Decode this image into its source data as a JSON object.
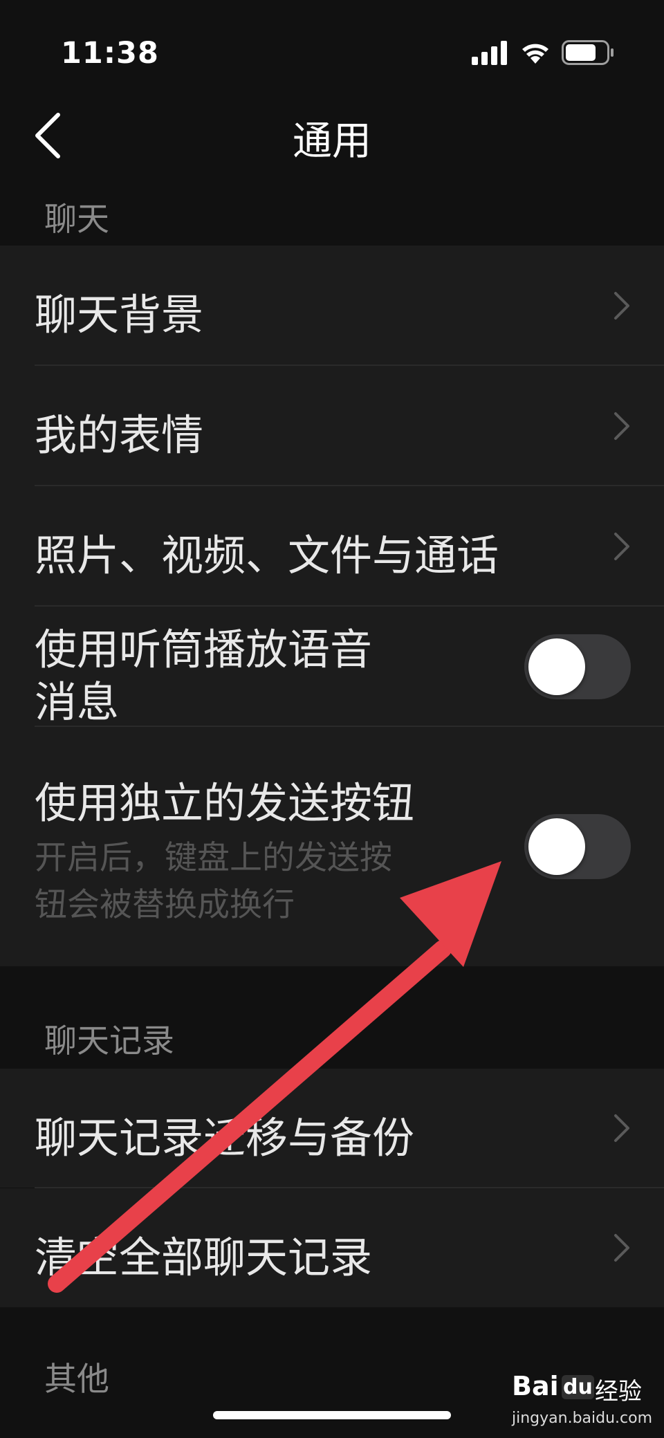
{
  "status_bar": {
    "time": "11:38",
    "icons": [
      "cellular-signal-icon",
      "wifi-icon",
      "battery-icon"
    ]
  },
  "nav": {
    "title": "通用",
    "back_icon": "chevron-left-icon"
  },
  "sections": {
    "chat": {
      "header": "聊天",
      "rows": {
        "background": "聊天背景",
        "stickers": "我的表情",
        "media": "照片、视频、文件与通话",
        "earpiece": {
          "label_line1": "使用听筒播放语音",
          "label_line2": "消息",
          "enabled": false
        },
        "send_button": {
          "label": "使用独立的发送按钮",
          "desc_line1": "开启后，键盘上的发送按",
          "desc_line2": "钮会被替换成换行",
          "enabled": false
        }
      }
    },
    "history": {
      "header": "聊天记录",
      "rows": {
        "migrate": "聊天记录迁移与备份",
        "clear": "清空全部聊天记录"
      }
    },
    "other": {
      "header": "其他"
    }
  },
  "annotation": {
    "arrow_color": "#e8414a"
  },
  "watermark": {
    "brand": "Bai",
    "paw": "du",
    "suffix": "经验",
    "url": "jingyan.baidu.com"
  },
  "colors": {
    "background": "#111111",
    "cell": "#1c1c1c",
    "toggle_off": "#3a3a3c"
  }
}
